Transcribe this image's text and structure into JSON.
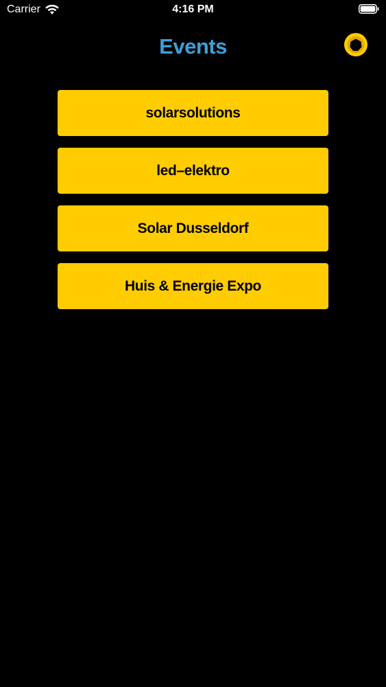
{
  "status_bar": {
    "carrier": "Carrier",
    "time": "4:16 PM"
  },
  "nav": {
    "title": "Events",
    "settings_icon": "gear-icon"
  },
  "events": [
    {
      "label": "solarsolutions"
    },
    {
      "label": "led–elektro"
    },
    {
      "label": "Solar Dusseldorf"
    },
    {
      "label": "Huis & Energie Expo"
    }
  ],
  "colors": {
    "background": "#000000",
    "title": "#3ea0d6",
    "button": "#ffcc00",
    "button_text": "#000000"
  }
}
